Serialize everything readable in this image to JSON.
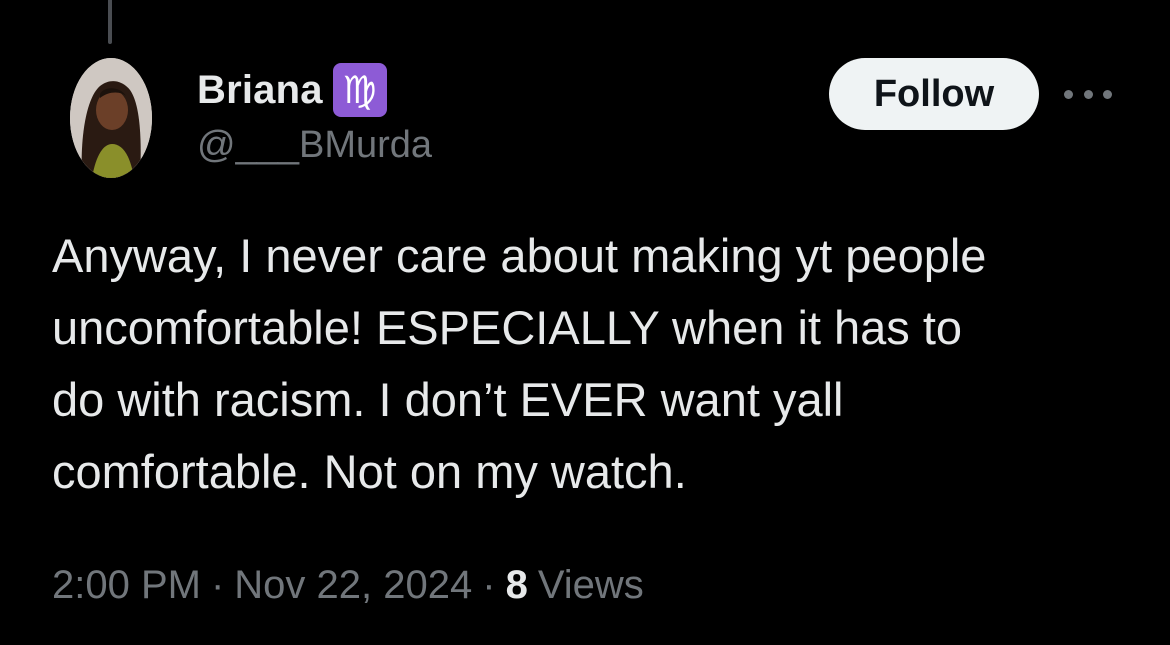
{
  "tweet": {
    "author": {
      "display_name": "Briana",
      "badge_symbol": "♍",
      "handle": "@___BMurda"
    },
    "follow_label": "Follow",
    "more_icon": "more-horizontal-icon",
    "text_lines": [
      "Anyway, I never care about making yt people",
      "uncomfortable! ESPECIALLY when it has to",
      "do with racism. I don’t EVER want yall",
      "comfortable. Not on my watch."
    ],
    "time": "2:00 PM",
    "separator": "·",
    "date": "Nov 22, 2024",
    "views_count": "8",
    "views_label": "Views"
  },
  "colors": {
    "background": "#000000",
    "primary_text": "#e7e9ea",
    "secondary_text": "#71767b",
    "follow_button_bg": "#eff3f4",
    "follow_button_text": "#0f1419",
    "badge_bg": "#8d5bd6"
  }
}
